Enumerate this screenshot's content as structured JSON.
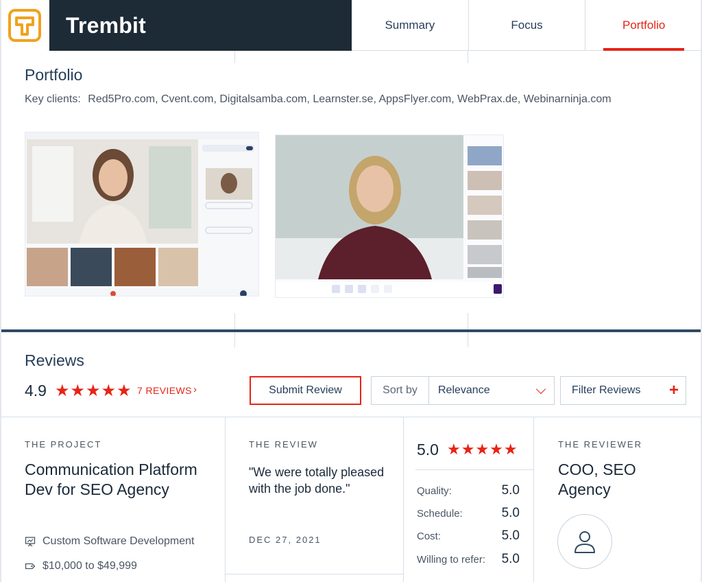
{
  "header": {
    "brand_name": "Trembit",
    "tabs": [
      {
        "label": "Summary",
        "active": false
      },
      {
        "label": "Focus",
        "active": false
      },
      {
        "label": "Portfolio",
        "active": true
      }
    ],
    "accent_color": "#e62415",
    "brand_bg": "#1d2b36"
  },
  "portfolio": {
    "title": "Portfolio",
    "key_clients_label": "Key clients:",
    "key_clients": "Red5Pro.com, Cvent.com, Digitalsamba.com, Learnster.se, AppsFlyer.com, WebPrax.de, Webinarninja.com"
  },
  "reviews": {
    "title": "Reviews",
    "rating": "4.9",
    "stars": "★★★★★",
    "count_link": "7 REVIEWS",
    "chevron": "›",
    "submit_label": "Submit Review",
    "sort_label": "Sort by",
    "sort_value": "Relevance",
    "filter_label": "Filter Reviews",
    "filter_plus": "+"
  },
  "review_card": {
    "project_label": "THE PROJECT",
    "project_title": "Communication Platform Dev for SEO Agency",
    "service": "Custom Software Development",
    "budget": "$10,000 to $49,999",
    "review_label": "THE REVIEW",
    "quote": "\"We were totally pleased with the job done.\"",
    "date": "DEC 27, 2021",
    "overall_score": "5.0",
    "overall_stars": "★★★★★",
    "scores": [
      {
        "label": "Quality:",
        "value": "5.0"
      },
      {
        "label": "Schedule:",
        "value": "5.0"
      },
      {
        "label": "Cost:",
        "value": "5.0"
      },
      {
        "label": "Willing to refer:",
        "value": "5.0"
      }
    ],
    "reviewer_label": "THE REVIEWER",
    "reviewer_title": "COO, SEO Agency"
  }
}
